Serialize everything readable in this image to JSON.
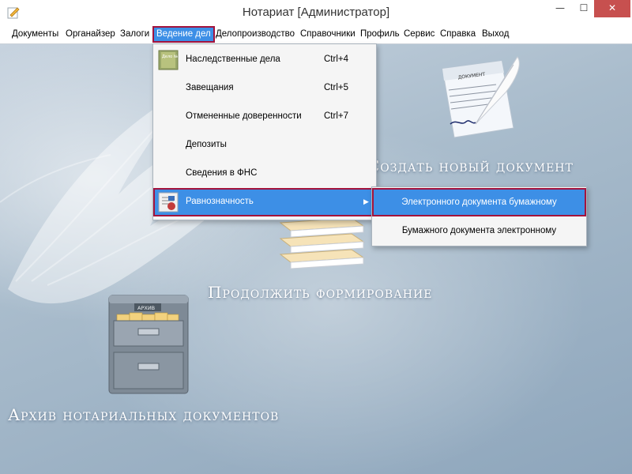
{
  "window": {
    "title": "Нотариат [Администратор]",
    "controls": {
      "minimize": "—",
      "maximize": "☐",
      "close": "✕"
    }
  },
  "menubar": {
    "items": [
      {
        "label": "Документы"
      },
      {
        "label": "Органайзер"
      },
      {
        "label": "Залоги"
      },
      {
        "label": "Ведение дел",
        "active": true
      },
      {
        "label": "Делопроизводство"
      },
      {
        "label": "Справочники"
      },
      {
        "label": "Профиль"
      },
      {
        "label": "Сервис"
      },
      {
        "label": "Справка"
      },
      {
        "label": "Выход"
      }
    ]
  },
  "dropdown": {
    "items": [
      {
        "label": "Наследственные дела",
        "shortcut": "Ctrl+4",
        "icon": "folder-icon"
      },
      {
        "label": "Завещания",
        "shortcut": "Ctrl+5"
      },
      {
        "label": "Отмененные доверенности",
        "shortcut": "Ctrl+7"
      },
      {
        "label": "Депозиты",
        "shortcut": ""
      },
      {
        "label": "Сведения в ФНС",
        "shortcut": ""
      },
      {
        "label": "Равнозначность",
        "shortcut": "",
        "icon": "stamp-document-icon",
        "selected": true,
        "has_submenu": true
      }
    ]
  },
  "submenu": {
    "items": [
      {
        "label": "Электронного документа бумажному",
        "selected": true
      },
      {
        "label": "Бумажного документа электронному"
      }
    ]
  },
  "workspace": {
    "create_doc_label": "Создать новый документ",
    "continue_label": "Продолжить формирование",
    "archive_label": "Архив нотариальных документов",
    "doc_icon_text": "ДОКУМЕНТ",
    "archive_icon_text": "АРХИВ",
    "folder_icon_text": "Дело №"
  },
  "colors": {
    "accent": "#3d8fe6",
    "highlight_border": "#a3133d",
    "close_button": "#c7504f"
  }
}
